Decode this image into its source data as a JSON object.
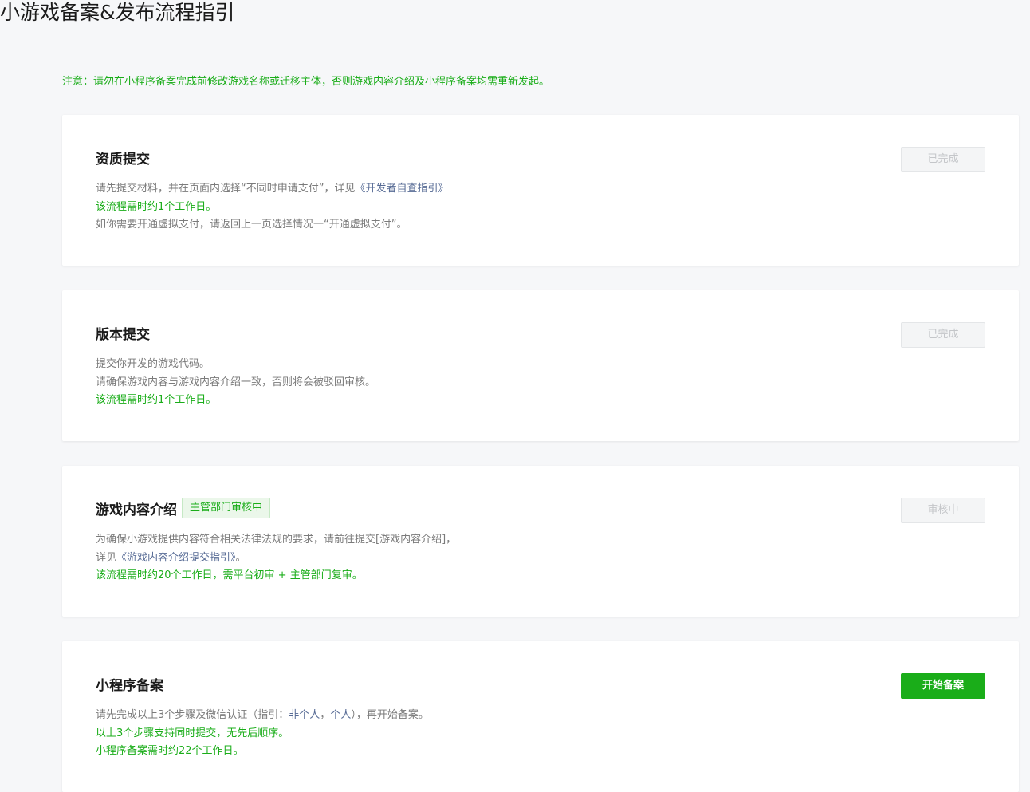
{
  "page_title": "小游戏备案&发布流程指引",
  "notice": "注意：请勿在小程序备案完成前修改游戏名称或迁移主体，否则游戏内容介绍及小程序备案均需重新发起。",
  "cards": [
    {
      "title": "资质提交",
      "button": "已完成",
      "lines": [
        {
          "text_before": "请先提交材料，并在页面内选择“不同时申请支付”，详见",
          "link": "《开发者自查指引》"
        },
        {
          "green": "该流程需时约1个工作日。"
        },
        {
          "text": "如你需要开通虚拟支付，请返回上一页选择情况一“开通虚拟支付”。"
        }
      ]
    },
    {
      "title": "版本提交",
      "button": "已完成",
      "lines": [
        {
          "text": "提交你开发的游戏代码。"
        },
        {
          "text": "请确保游戏内容与游戏内容介绍一致，否则将会被驳回审核。"
        },
        {
          "green": "该流程需时约1个工作日。"
        }
      ]
    },
    {
      "title": "游戏内容介绍",
      "tag": "主管部门审核中",
      "button": "审核中",
      "lines": [
        {
          "text": "为确保小游戏提供内容符合相关法律法规的要求，请前往提交[游戏内容介绍]，"
        },
        {
          "text_before": "详见",
          "link": "《游戏内容介绍提交指引》",
          "text_after": "。"
        },
        {
          "green": "该流程需时约20个工作日，需平台初审 + 主管部门复审。"
        }
      ]
    },
    {
      "title": "小程序备案",
      "button": "开始备案",
      "lines": [
        {
          "text_before": "请先完成以上3个步骤及微信认证（指引：",
          "link": "非个人",
          "text_mid": "，",
          "link2": "个人",
          "text_after": "），再开始备案。"
        },
        {
          "green": "以上3个步骤支持同时提交，无先后顺序。"
        },
        {
          "green": "小程序备案需时约22个工作日。"
        }
      ]
    }
  ],
  "colors": {
    "brand_green": "#1aad19",
    "link_blue": "#576b95",
    "muted_text": "#7b7b7b"
  }
}
